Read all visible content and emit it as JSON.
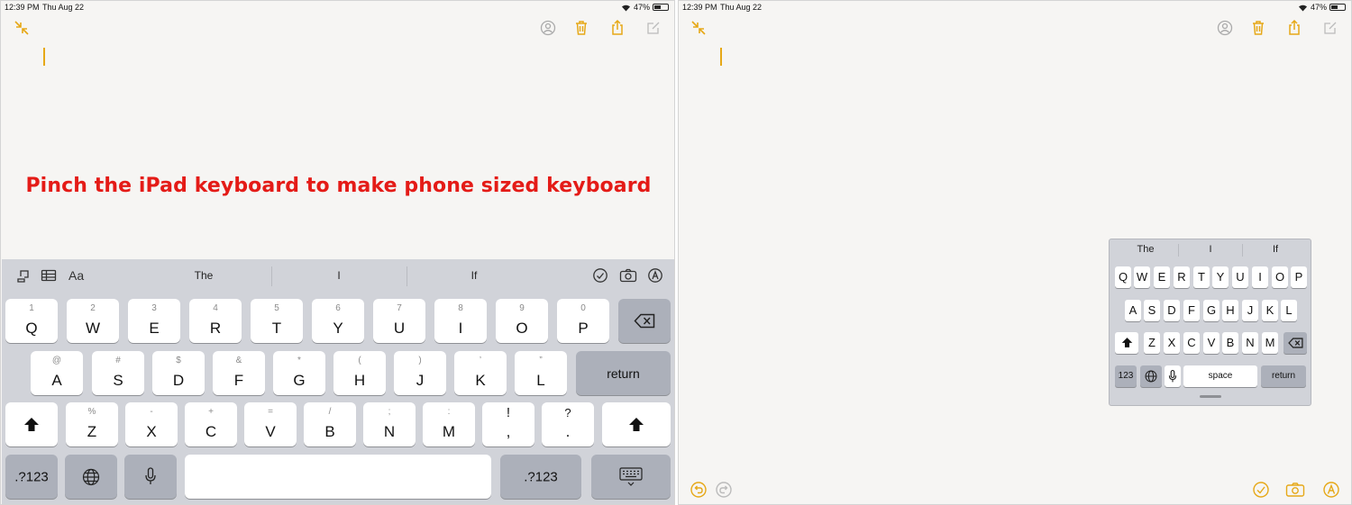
{
  "colors": {
    "accent": "#e6a817",
    "overlay": "#e41b17",
    "keyboard_bg": "#d1d3d9"
  },
  "left": {
    "status": {
      "time": "12:39 PM",
      "date": "Thu Aug 22",
      "battery": "47%"
    },
    "toolbar_icons": [
      "collapse-icon",
      "share-people-icon",
      "trash-icon",
      "share-icon",
      "compose-icon"
    ],
    "overlay_text": "Pinch the iPad keyboard to make phone sized keyboard",
    "keyboard": {
      "bar_left_icons": [
        "undo-icon",
        "table-icon",
        "text-format-icon"
      ],
      "suggestions": [
        "The",
        "I",
        "If"
      ],
      "bar_right_icons": [
        "checklist-icon",
        "camera-icon",
        "markup-icon"
      ],
      "row1": [
        {
          "alt": "1",
          "main": "Q"
        },
        {
          "alt": "2",
          "main": "W"
        },
        {
          "alt": "3",
          "main": "E"
        },
        {
          "alt": "4",
          "main": "R"
        },
        {
          "alt": "5",
          "main": "T"
        },
        {
          "alt": "6",
          "main": "Y"
        },
        {
          "alt": "7",
          "main": "U"
        },
        {
          "alt": "8",
          "main": "I"
        },
        {
          "alt": "9",
          "main": "O"
        },
        {
          "alt": "0",
          "main": "P"
        }
      ],
      "row2": [
        {
          "alt": "@",
          "main": "A"
        },
        {
          "alt": "#",
          "main": "S"
        },
        {
          "alt": "$",
          "main": "D"
        },
        {
          "alt": "&",
          "main": "F"
        },
        {
          "alt": "*",
          "main": "G"
        },
        {
          "alt": "(",
          "main": "H"
        },
        {
          "alt": ")",
          "main": "J"
        },
        {
          "alt": "’",
          "main": "K"
        },
        {
          "alt": "”",
          "main": "L"
        }
      ],
      "row3": [
        {
          "alt": "%",
          "main": "Z"
        },
        {
          "alt": "-",
          "main": "X"
        },
        {
          "alt": "+",
          "main": "C"
        },
        {
          "alt": "=",
          "main": "V"
        },
        {
          "alt": "/",
          "main": "B"
        },
        {
          "alt": ";",
          "main": "N"
        },
        {
          "alt": ":",
          "main": "M"
        },
        {
          "alt": "!",
          "main": ","
        },
        {
          "alt": "?",
          "main": "."
        }
      ],
      "return_label": "return",
      "numbers_label": ".?123"
    }
  },
  "right": {
    "status": {
      "time": "12:39 PM",
      "date": "Thu Aug 22",
      "battery": "47%"
    },
    "mini_keyboard": {
      "suggestions": [
        "The",
        "I",
        "If"
      ],
      "row1": [
        "Q",
        "W",
        "E",
        "R",
        "T",
        "Y",
        "U",
        "I",
        "O",
        "P"
      ],
      "row2": [
        "A",
        "S",
        "D",
        "F",
        "G",
        "H",
        "J",
        "K",
        "L"
      ],
      "row3": [
        "Z",
        "X",
        "C",
        "V",
        "B",
        "N",
        "M"
      ],
      "numbers_label": "123",
      "space_label": "space",
      "return_label": "return"
    },
    "bottom_icons": [
      "undo-icon",
      "redo-icon",
      "checklist-icon",
      "camera-icon",
      "markup-icon"
    ]
  }
}
